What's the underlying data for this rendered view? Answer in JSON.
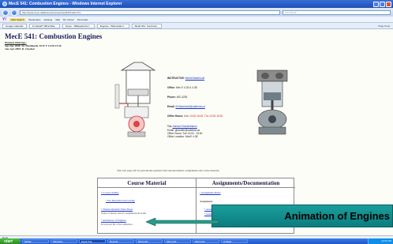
{
  "window": {
    "title": "MecE 541: Combustion Engines - Windows Internet Explorer"
  },
  "browser": {
    "url": "http://www.mece.ualberta.ca/courses/mec541/index.htm",
    "search_placeholder": "Live Search",
    "links": [
      "Y!",
      "Web Search",
      "Bookmarks",
      "Settings",
      "Mail",
      "My Yahoo!",
      "Personals"
    ],
    "tabs": [
      "Google Calendar",
      "An Island? What Was...",
      "Home - Wikipedia the f...",
      "Engines - Wikimedia C...",
      "MecE 541: Combusti..."
    ],
    "tab_tools": "Page  Tools"
  },
  "page": {
    "title": "MecE 541: Combustion Engines",
    "schedule": [
      "Planned Offerings:",
      "Sep-Dec 2008: M. Mashhoufi, M W F 13:00-13:50",
      "Jan-Apr 2009: D. Checkel"
    ],
    "info": {
      "instructor_label": "INSTRUCTOR:",
      "instructor_name": "Mehdi Mashhoufi",
      "office_label": "Office:",
      "office_value": "Mec E 4-33 & 4-38",
      "phone_label": "Phone:",
      "phone_value": "492-4235",
      "email_label": "Email:",
      "email_value": "M.Mashhoufi@ualberta.ca",
      "hours_label": "Office Hours:",
      "hours_value": "Mon 14:00-16:00, Thu 13:00-15:00",
      "ta_label": "T.A:",
      "ta_name": "Ahmad Ghandehariun",
      "ta_email": "Email: ghandeh@ualberta.ca",
      "ta_hours": "Office Hours: Tue 14:00 - 15:00",
      "ta_office": "Office Location: MecE 4-38"
    },
    "announcement": "This web page will be periodically updated with announcements, assignments and course material."
  },
  "table": {
    "left_header": "Course Material",
    "right_header": "Assignments/Documentation",
    "left_items": [
      "Course Outline",
      "Pre-Requisite Knowledge",
      "Thermodynamic Data Sheet",
      "Animation of Engines"
    ],
    "left_notes": [
      "Tables of thermo data for assignments & exams",
      "Powerpoint file of the animation..."
    ],
    "right_items": [
      "Assignment Rules"
    ],
    "right_label": "Assignments:",
    "right_bullets": [
      "Assignment 1",
      "Solution"
    ]
  },
  "callout": {
    "text": "Animation of Engines"
  },
  "statusbar": {
    "text": "Done"
  },
  "taskbar": {
    "start": "start",
    "tasks": [
      "Mobile",
      "Windows...",
      "MecE 541...",
      "NeoCal...",
      "Microsoft...",
      "Microsoft...",
      "Microsoft...",
      "Untitled..."
    ],
    "clock": "12:31 PM"
  },
  "colors": {
    "callout": "#0b7d7f",
    "arrow": "#2a9a8c",
    "link": "#1a35c8",
    "title_bar": "#1d4fb8"
  }
}
